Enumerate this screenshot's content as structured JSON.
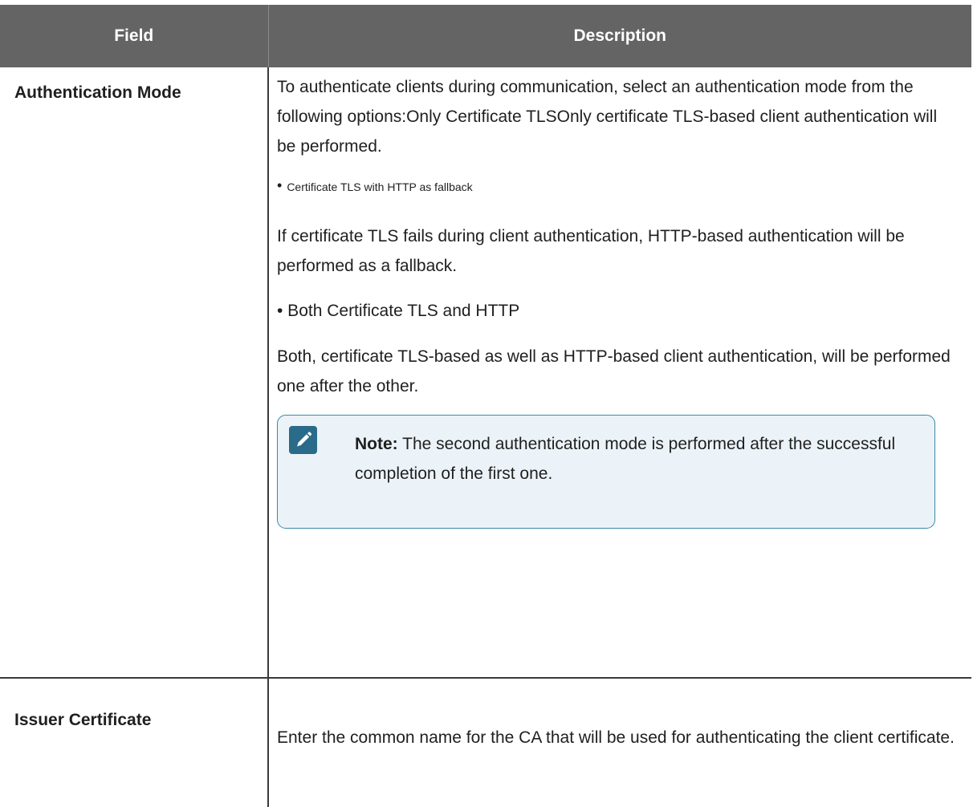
{
  "table": {
    "headers": {
      "field": "Field",
      "description": "Description"
    },
    "rows": [
      {
        "field": "Authentication Mode",
        "intro": "To authenticate clients during communication, select an authentication mode from the following options:Only Certificate TLSOnly certificate TLS-based client authentication will be performed.",
        "bullet_small": "Certificate TLS with HTTP as fallback",
        "fallback_desc": "If certificate TLS fails during client authentication, HTTP-based authentication will be performed as a fallback.",
        "bullet_both": "• Both Certificate TLS and HTTP",
        "both_desc": "Both, certificate TLS-based as well as HTTP-based client authentication, will be performed one after the other.",
        "note": {
          "icon": "pencil-icon",
          "label": "Note:",
          "text": " The second authentication mode is performed after the successful completion of the first one."
        }
      },
      {
        "field": "Issuer Certificate",
        "description": "Enter the common name for the CA that will be used for authenticating the client certificate."
      }
    ]
  },
  "colors": {
    "header_bg": "#646464",
    "note_border": "#3a8aa7",
    "note_bg": "#ebf3f8",
    "note_icon_bg": "#2a6b89"
  }
}
